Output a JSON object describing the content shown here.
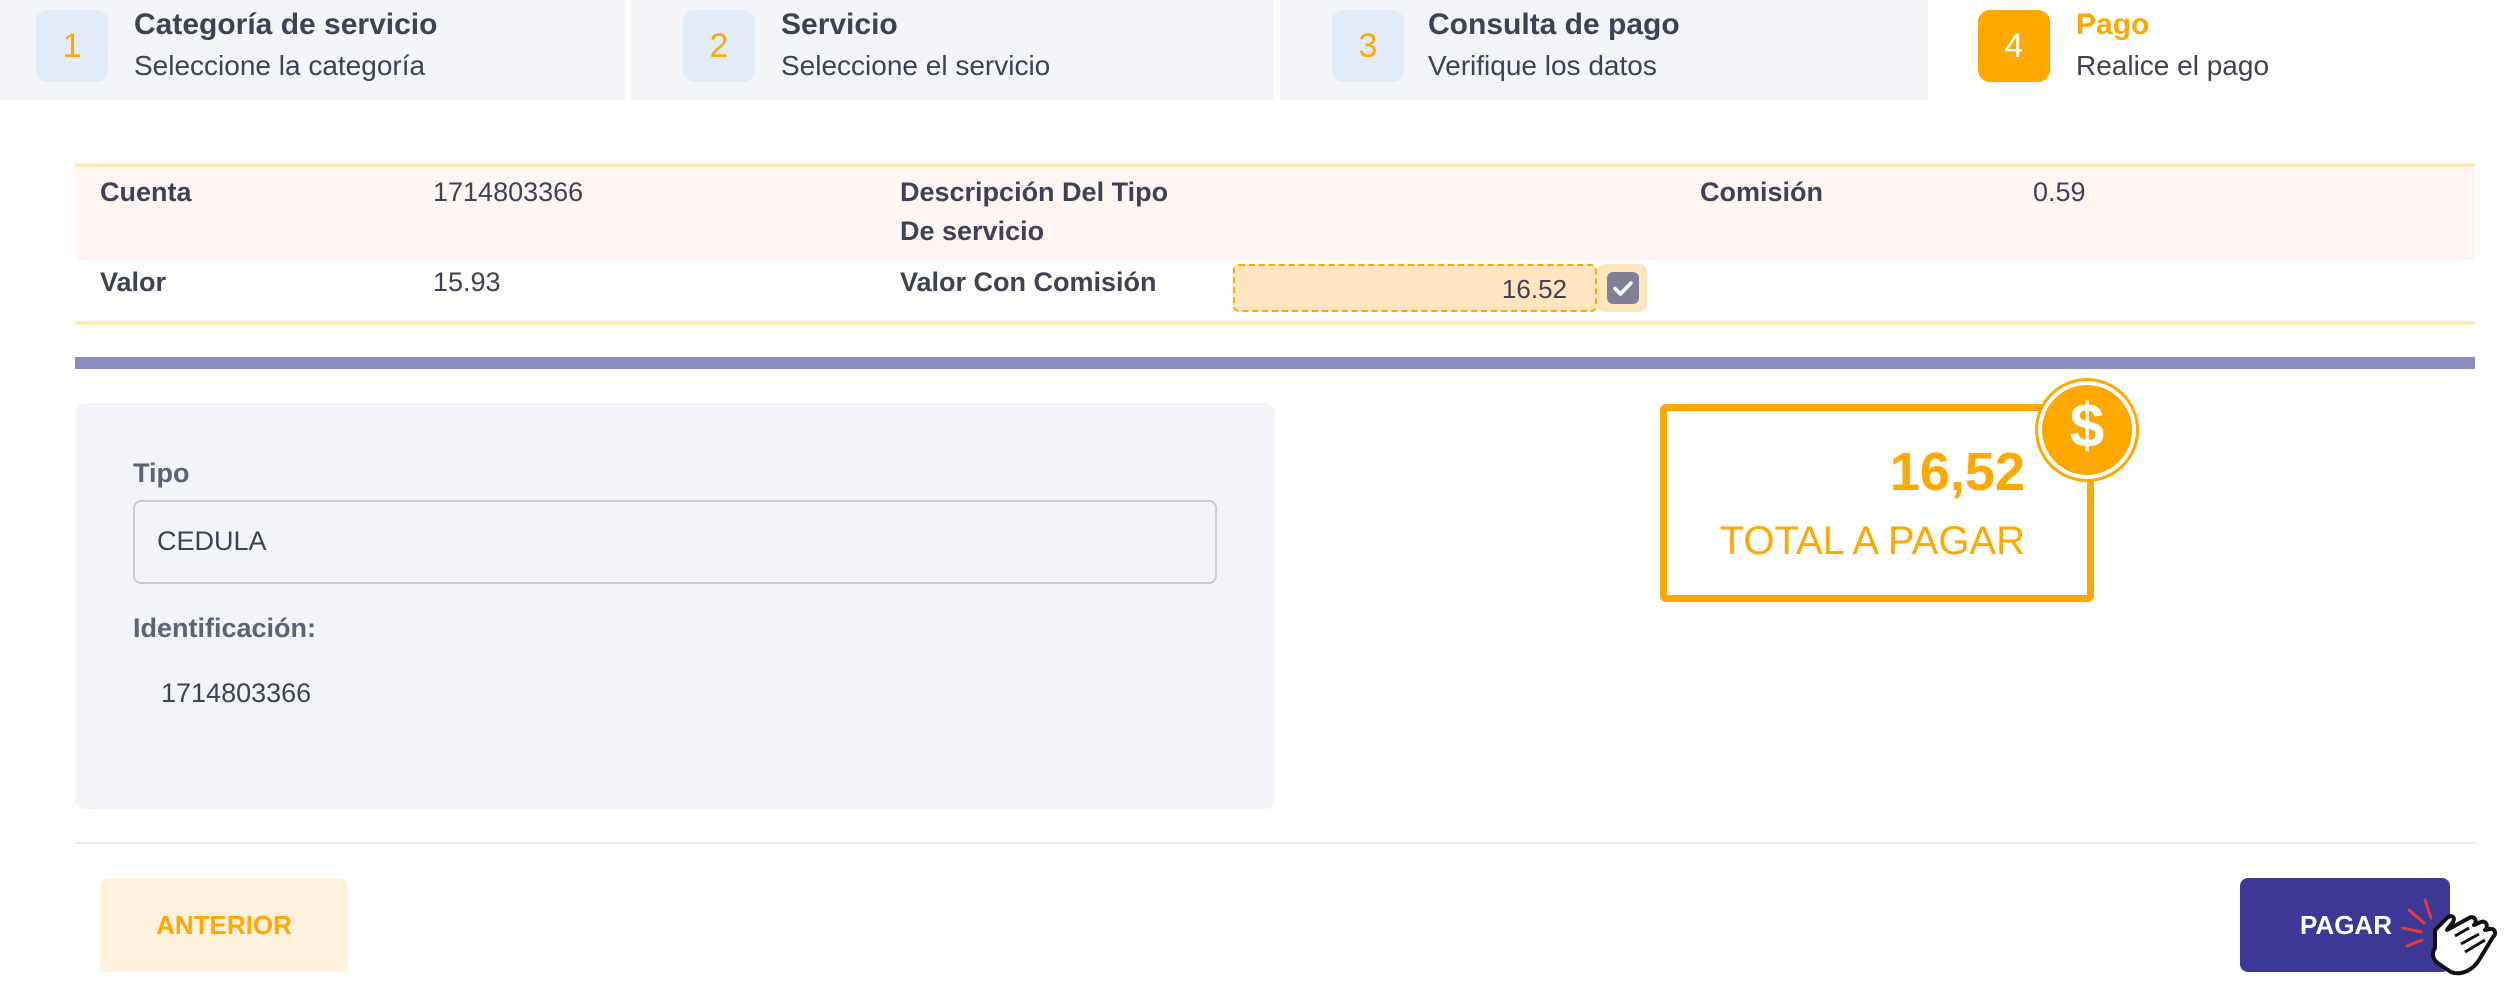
{
  "stepper": {
    "steps": [
      {
        "number": "1",
        "title": "Categoría de servicio",
        "subtitle": "Seleccione la categoría"
      },
      {
        "number": "2",
        "title": "Servicio",
        "subtitle": "Seleccione el servicio"
      },
      {
        "number": "3",
        "title": "Consulta de pago",
        "subtitle": "Verifique los datos"
      },
      {
        "number": "4",
        "title": "Pago",
        "subtitle": "Realice el pago"
      }
    ],
    "active_step": 4
  },
  "details": {
    "cuenta_label": "Cuenta",
    "cuenta_value": "1714803366",
    "descripcion_label_line1": "Descripción Del Tipo",
    "descripcion_label_line2": "De servicio",
    "comision_label": "Comisión",
    "comision_value": "0.59",
    "valor_label": "Valor",
    "valor_value": "15.93",
    "valor_con_comision_label": "Valor Con Comisión",
    "valor_con_comision_value": "16.52"
  },
  "form": {
    "tipo_label": "Tipo",
    "tipo_value": "CEDULA",
    "identificacion_label": "Identificación:",
    "identificacion_value": "1714803366"
  },
  "total": {
    "amount": "16,52",
    "label": "TOTAL A PAGAR",
    "coin_symbol": "$"
  },
  "buttons": {
    "previous": "ANTERIOR",
    "pay": "PAGAR"
  },
  "colors": {
    "accent": "#ffa800",
    "primary": "#3b3896",
    "divider": "#8c8cc4"
  }
}
